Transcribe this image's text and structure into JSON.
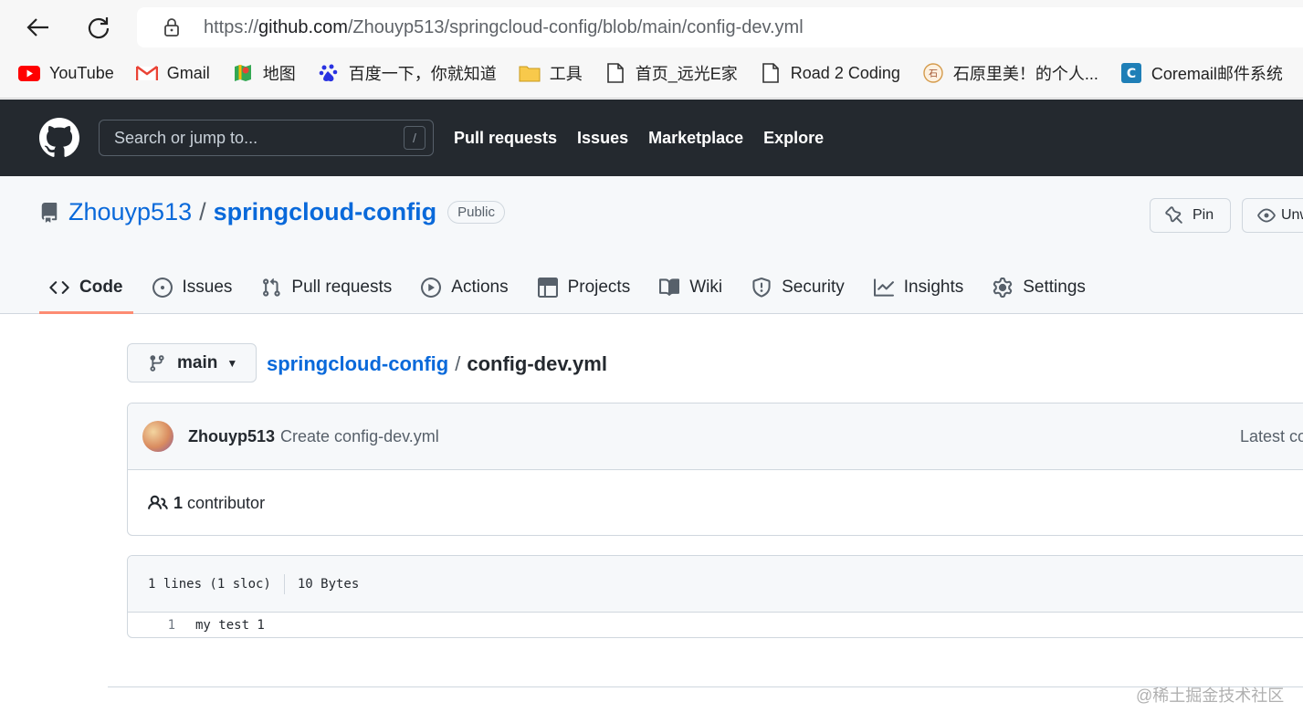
{
  "browser": {
    "url_prefix": "https://",
    "url_host": "github.com",
    "url_path": "/Zhouyp513/springcloud-config/blob/main/config-dev.yml",
    "bookmarks": [
      {
        "label": "YouTube",
        "icon": "youtube-icon"
      },
      {
        "label": "Gmail",
        "icon": "gmail-icon"
      },
      {
        "label": "地图",
        "icon": "maps-icon"
      },
      {
        "label": "百度一下，你就知道",
        "icon": "baidu-icon"
      },
      {
        "label": "工具",
        "icon": "folder-icon"
      },
      {
        "label": "首页_远光E家",
        "icon": "page-icon"
      },
      {
        "label": "Road 2 Coding",
        "icon": "page-icon"
      },
      {
        "label": "石原里美！的个人...",
        "icon": "site-icon"
      },
      {
        "label": "Coremail邮件系统",
        "icon": "coremail-icon"
      }
    ]
  },
  "header": {
    "search_placeholder": "Search or jump to...",
    "search_shortcut": "/",
    "links": [
      "Pull requests",
      "Issues",
      "Marketplace",
      "Explore"
    ]
  },
  "repo": {
    "owner": "Zhouyp513",
    "separator": "/",
    "name": "springcloud-config",
    "visibility": "Public",
    "pin_label": "Pin",
    "watch_label": "Unwatch"
  },
  "tabs": [
    {
      "label": "Code",
      "icon": "code-icon",
      "active": true
    },
    {
      "label": "Issues",
      "icon": "issue-icon"
    },
    {
      "label": "Pull requests",
      "icon": "pull-request-icon"
    },
    {
      "label": "Actions",
      "icon": "play-icon"
    },
    {
      "label": "Projects",
      "icon": "table-icon"
    },
    {
      "label": "Wiki",
      "icon": "book-icon"
    },
    {
      "label": "Security",
      "icon": "shield-icon"
    },
    {
      "label": "Insights",
      "icon": "graph-icon"
    },
    {
      "label": "Settings",
      "icon": "gear-icon"
    }
  ],
  "file_nav": {
    "branch": "main",
    "root": "springcloud-config",
    "separator": "/",
    "file": "config-dev.yml"
  },
  "commit": {
    "author": "Zhouyp513",
    "message": "Create config-dev.yml",
    "latest": "Latest co"
  },
  "contributors": {
    "count": "1",
    "label": "contributor"
  },
  "file": {
    "lines_info": "1 lines (1 sloc)",
    "size": "10 Bytes",
    "code": [
      {
        "number": "1",
        "text": "my test 1"
      }
    ]
  },
  "watermark": "@稀土掘金技术社区",
  "colors": {
    "header_bg": "#24292f",
    "link": "#0969da",
    "active_tab_underline": "#fd8c73"
  }
}
